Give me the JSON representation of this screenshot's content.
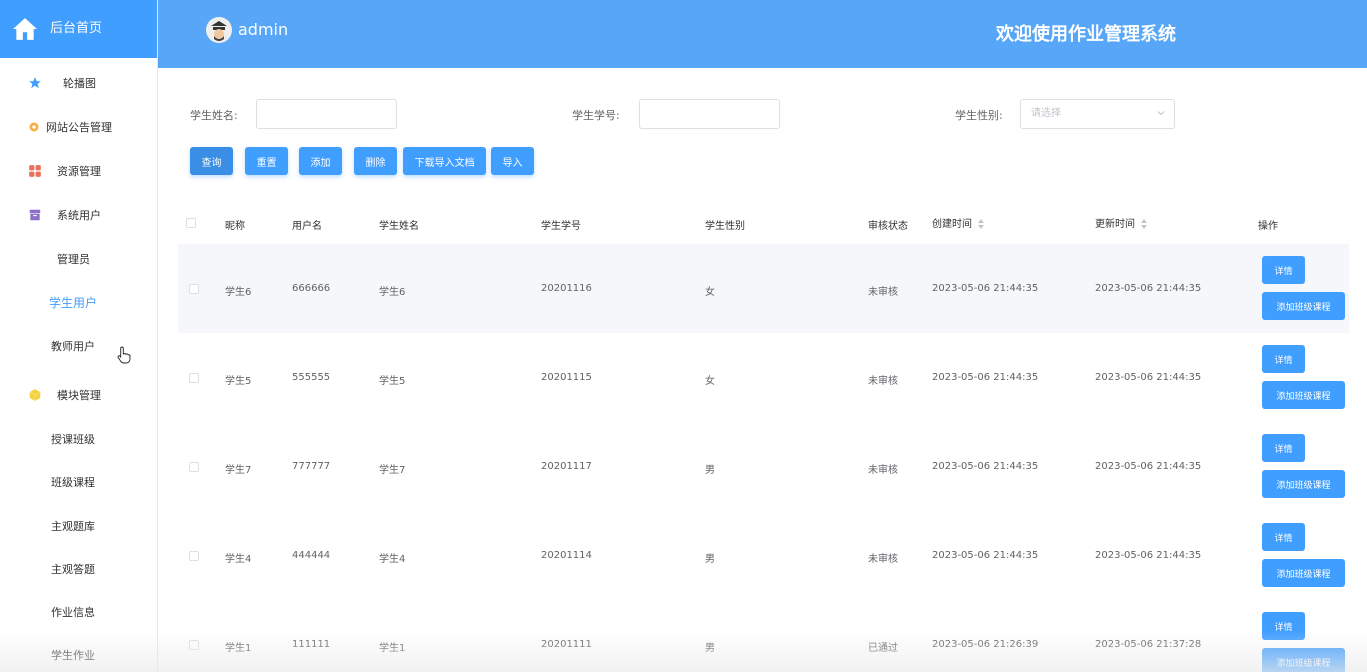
{
  "sidebar": {
    "home_label": "后台首页",
    "items": [
      {
        "label": "轮播图",
        "icon": "star-icon"
      },
      {
        "label": "网站公告管理",
        "icon": "gear-icon"
      },
      {
        "label": "资源管理",
        "icon": "grid-icon"
      },
      {
        "label": "系统用户",
        "icon": "box-icon"
      },
      {
        "label": "管理员"
      },
      {
        "label": "学生用户",
        "active": true
      },
      {
        "label": "教师用户"
      },
      {
        "label": "模块管理",
        "icon": "cube-icon"
      },
      {
        "label": "授课班级"
      },
      {
        "label": "班级课程"
      },
      {
        "label": "主观题库"
      },
      {
        "label": "主观答题"
      },
      {
        "label": "作业信息"
      },
      {
        "label": "学生作业"
      }
    ]
  },
  "header": {
    "username": "admin",
    "title": "欢迎使用作业管理系统"
  },
  "filters": {
    "name_label": "学生姓名:",
    "number_label": "学生学号:",
    "gender_label": "学生性别:",
    "gender_placeholder": "请选择"
  },
  "buttons": {
    "query": "查询",
    "reset": "重置",
    "add": "添加",
    "delete": "删除",
    "download": "下载导入文档",
    "import": "导入"
  },
  "table": {
    "headers": [
      "昵称",
      "用户名",
      "学生姓名",
      "学生学号",
      "学生性别",
      "审核状态",
      "创建时间",
      "更新时间",
      "操作"
    ],
    "detail_label": "详情",
    "add_course_label": "添加班级课程",
    "rows": [
      {
        "nickname": "学生6",
        "username": "666666",
        "name": "学生6",
        "number": "20201116",
        "gender": "女",
        "status": "未审核",
        "created": "2023-05-06 21:44:35",
        "updated": "2023-05-06 21:44:35"
      },
      {
        "nickname": "学生5",
        "username": "555555",
        "name": "学生5",
        "number": "20201115",
        "gender": "女",
        "status": "未审核",
        "created": "2023-05-06 21:44:35",
        "updated": "2023-05-06 21:44:35"
      },
      {
        "nickname": "学生7",
        "username": "777777",
        "name": "学生7",
        "number": "20201117",
        "gender": "男",
        "status": "未审核",
        "created": "2023-05-06 21:44:35",
        "updated": "2023-05-06 21:44:35"
      },
      {
        "nickname": "学生4",
        "username": "444444",
        "name": "学生4",
        "number": "20201114",
        "gender": "男",
        "status": "未审核",
        "created": "2023-05-06 21:44:35",
        "updated": "2023-05-06 21:44:35"
      },
      {
        "nickname": "学生1",
        "username": "111111",
        "name": "学生1",
        "number": "20201111",
        "gender": "男",
        "status": "已通过",
        "created": "2023-05-06 21:26:39",
        "updated": "2023-05-06 21:37:28"
      }
    ]
  },
  "colors": {
    "primary": "#409eff",
    "header_bg": "#57a6f7"
  }
}
